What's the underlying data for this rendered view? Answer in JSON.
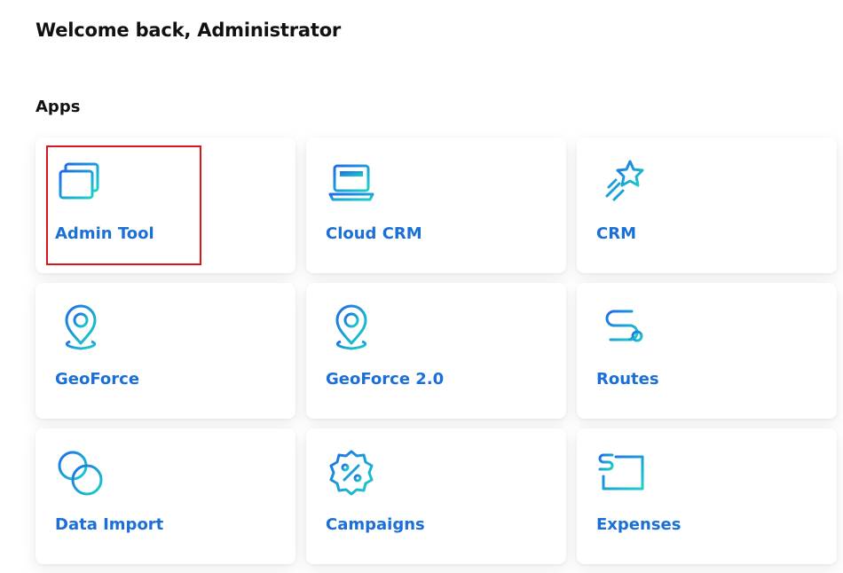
{
  "header": {
    "welcome": "Welcome back, Administrator"
  },
  "apps_section": {
    "title": "Apps",
    "tiles": [
      {
        "label": "Admin Tool",
        "icon": "windows-stack-icon",
        "highlighted": true
      },
      {
        "label": "Cloud CRM",
        "icon": "laptop-icon"
      },
      {
        "label": "CRM",
        "icon": "shooting-star-icon"
      },
      {
        "label": "GeoForce",
        "icon": "map-pin-icon"
      },
      {
        "label": "GeoForce 2.0",
        "icon": "map-pin-icon"
      },
      {
        "label": "Routes",
        "icon": "route-icon"
      },
      {
        "label": "Data Import",
        "icon": "overlapping-circles-icon"
      },
      {
        "label": "Campaigns",
        "icon": "percent-badge-icon"
      },
      {
        "label": "Expenses",
        "icon": "expense-sheet-icon"
      }
    ]
  },
  "colors": {
    "label_blue": "#1b6fd8",
    "icon_gradient_start": "#1e6bea",
    "icon_gradient_end": "#19d3c5",
    "highlight_red": "#d8161b"
  }
}
